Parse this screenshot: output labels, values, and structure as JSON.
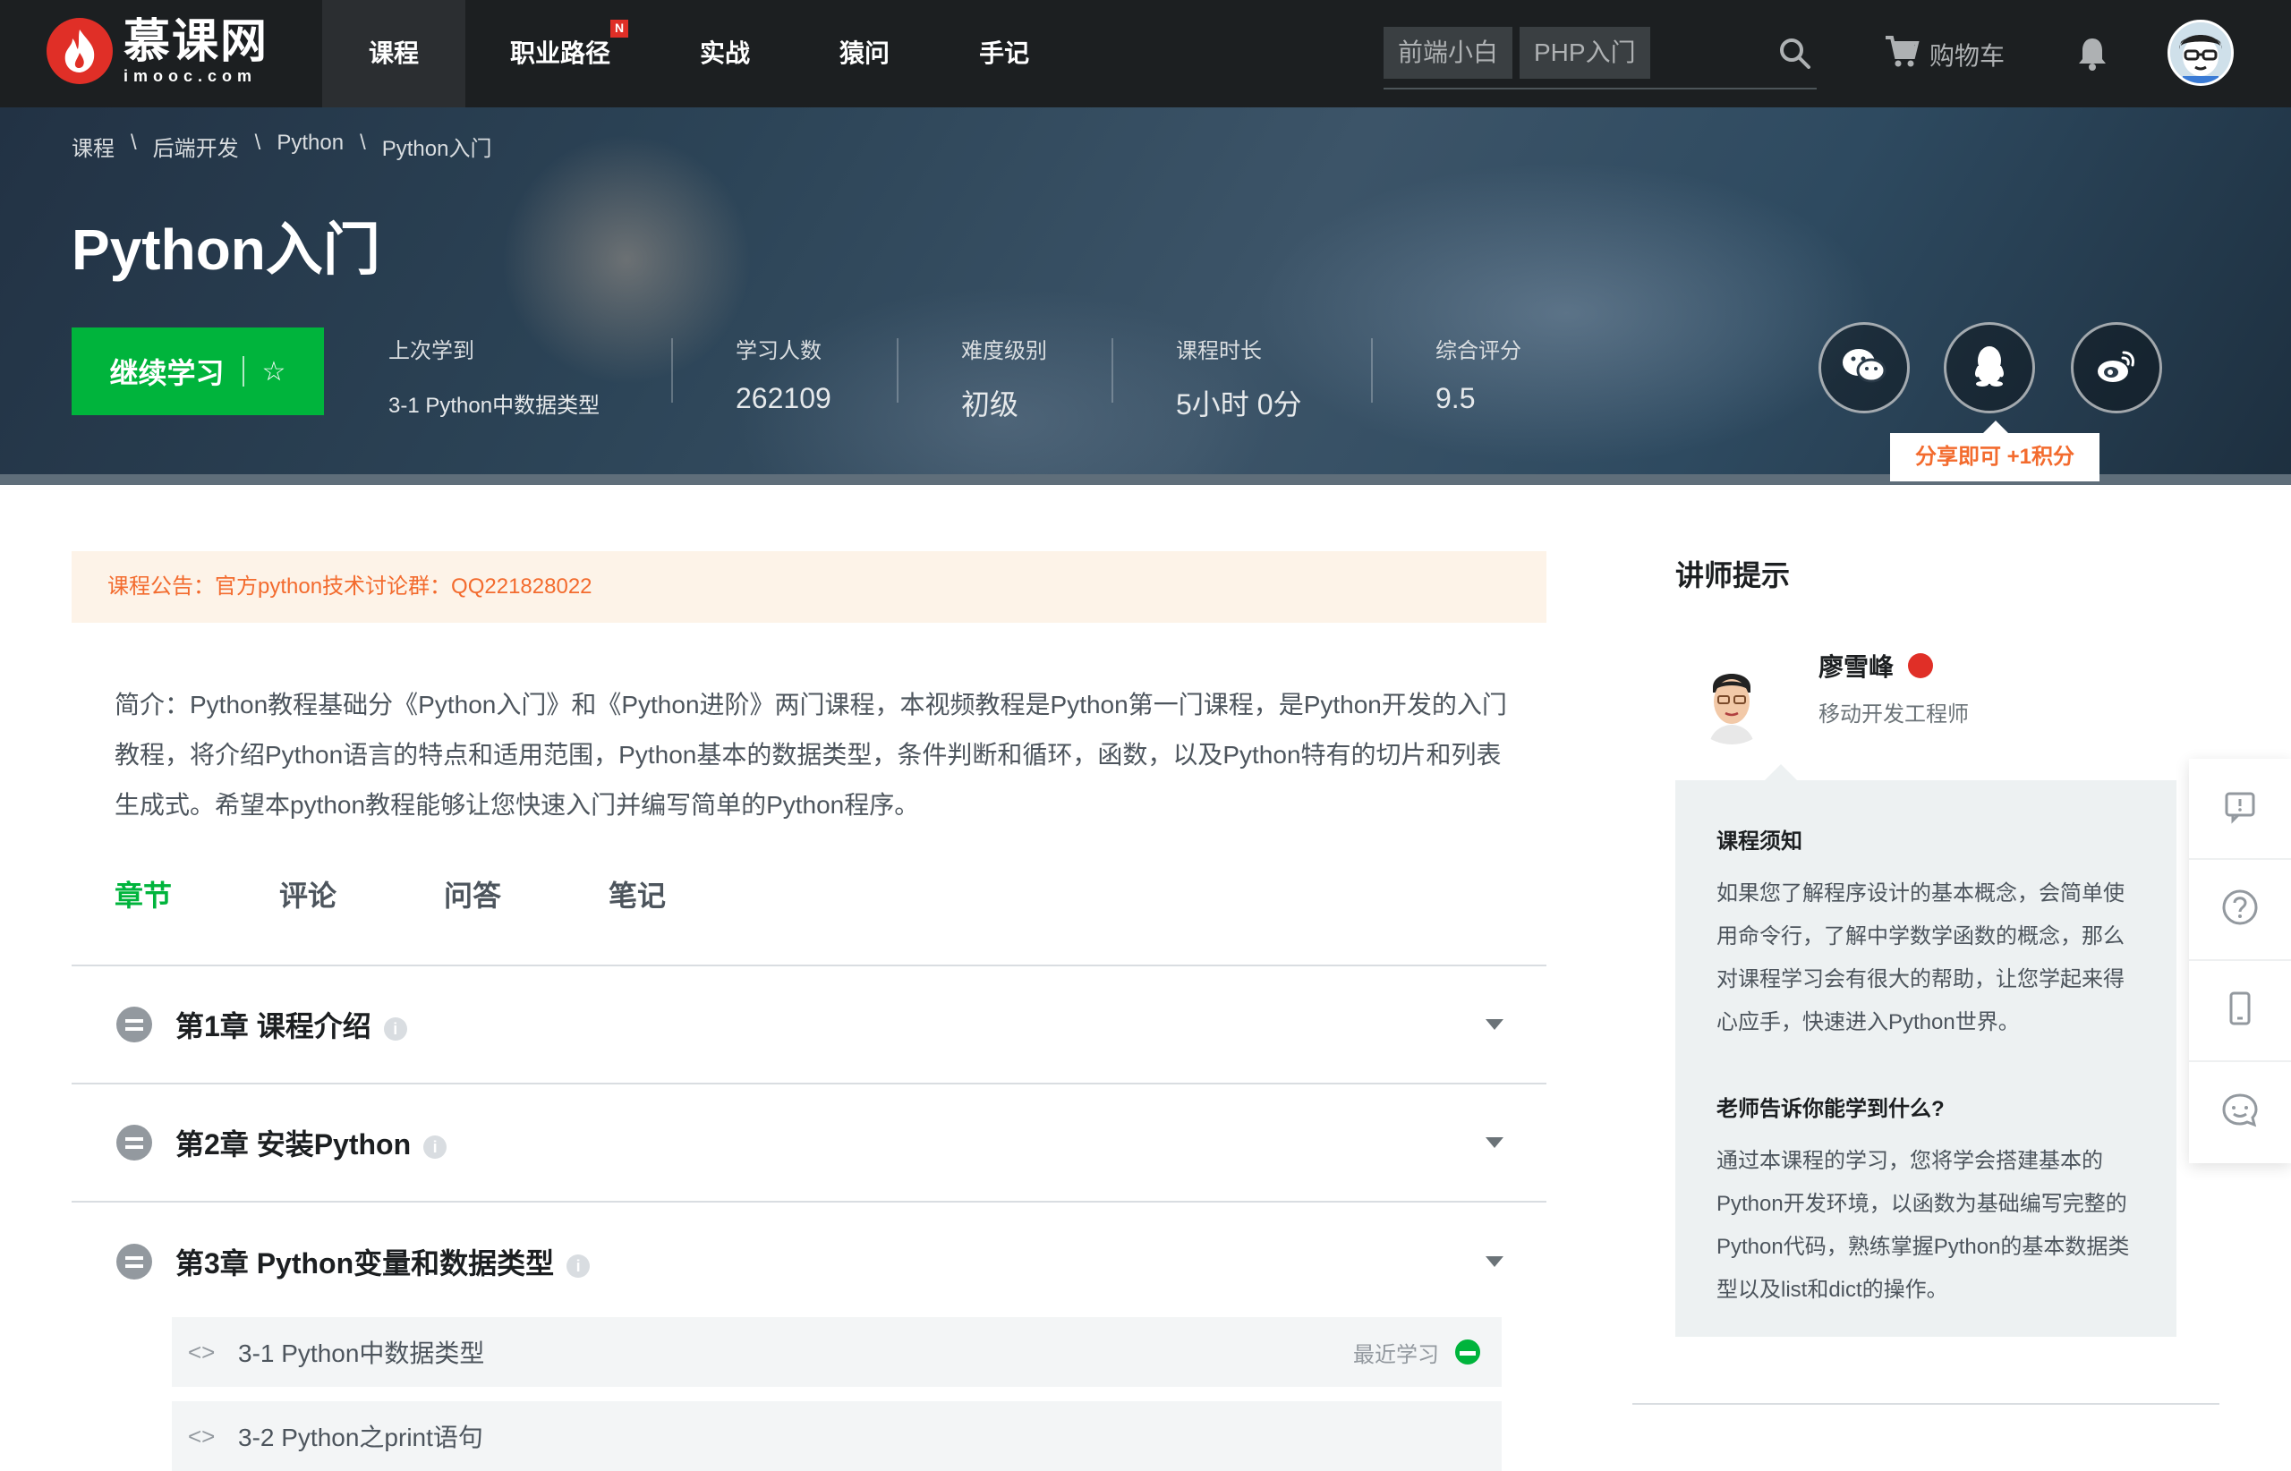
{
  "nav": {
    "logo_cn": "慕课网",
    "logo_en": "imooc.com",
    "items": [
      "课程",
      "职业路径",
      "实战",
      "猿问",
      "手记"
    ],
    "badge": "N",
    "search_tags": [
      "前端小白",
      "PHP入门"
    ],
    "cart_label": "购物车"
  },
  "hero": {
    "breadcrumbs": [
      "课程",
      "\\",
      "后端开发",
      "\\",
      "Python",
      "\\",
      "Python入门"
    ],
    "title": "Python入门",
    "continue_label": "继续学习",
    "star": "☆",
    "last_learned_label": "上次学到",
    "last_learned_value": "3-1 Python中数据类型",
    "stats": [
      {
        "label": "学习人数",
        "value": "262109"
      },
      {
        "label": "难度级别",
        "value": "初级"
      },
      {
        "label": "课程时长",
        "value": "5小时 0分"
      },
      {
        "label": "综合评分",
        "value": "9.5"
      }
    ],
    "share_tip": "分享即可 +1积分"
  },
  "notice": "课程公告：官方python技术讨论群：QQ221828022",
  "intro": "简介：Python教程基础分《Python入门》和《Python进阶》两门课程，本视频教程是Python第一门课程，是Python开发的入门教程，将介绍Python语言的特点和适用范围，Python基本的数据类型，条件判断和循环，函数，以及Python特有的切片和列表生成式。希望本python教程能够让您快速入门并编写简单的Python程序。",
  "tabs": [
    "章节",
    "评论",
    "问答",
    "笔记"
  ],
  "chapters": [
    {
      "title": "第1章 课程介绍"
    },
    {
      "title": "第2章 安装Python"
    },
    {
      "title": "第3章 Python变量和数据类型"
    }
  ],
  "sections": [
    {
      "icon": "<>",
      "title": "3-1 Python中数据类型",
      "status": "最近学习"
    },
    {
      "icon": "<>",
      "title": "3-2 Python之print语句",
      "status": ""
    }
  ],
  "info_glyph": "i",
  "sidebar": {
    "title": "讲师提示",
    "teacher_name": "廖雪峰",
    "teacher_role": "移动开发工程师",
    "notes_title": "课程须知",
    "notes_text": "如果您了解程序设计的基本概念，会简单使用命令行，了解中学数学函数的概念，那么对课程学习会有很大的帮助，让您学起来得心应手，快速进入Python世界。",
    "learn_title": "老师告诉你能学到什么?",
    "learn_text": "通过本课程的学习，您将学会搭建基本的Python开发环境，以函数为基础编写完整的Python代码，熟练掌握Python的基本数据类型以及list和dict的操作。"
  },
  "colors": {
    "accent": "#00b43c",
    "nav_bg": "#1c1f21",
    "notice": "#f36b2e",
    "brand": "#e02f27"
  }
}
